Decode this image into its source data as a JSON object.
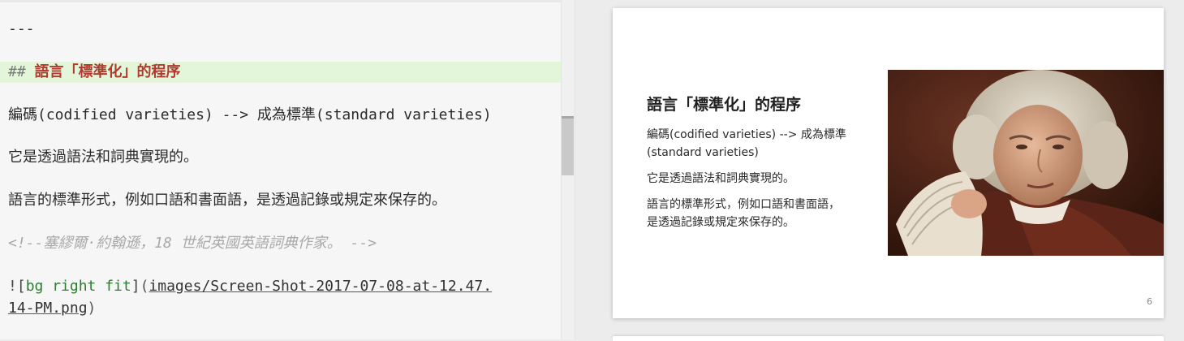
{
  "editor": {
    "separator": "---",
    "heading_mark": "##",
    "heading_text": "語言「標準化」的程序",
    "line_codified": "編碼(codified varieties) --> 成為標準(standard varieties)",
    "line_grammar": "它是透過語法和詞典實現的。",
    "line_forms": "語言的標準形式，例如口語和書面語，是透過記錄或規定來保存的。",
    "comment": "<!--塞繆爾·約翰遜，18  世紀英國英語詞典作家。 -->",
    "image_bang": "!",
    "image_alt_open": "[",
    "image_alt": "bg right fit",
    "image_alt_close": "]",
    "image_paren_open": "(",
    "image_url_line1": "images/Screen-Shot-2017-07-08-at-12.47.",
    "image_url_line2": "14-PM.png",
    "image_paren_close": ")"
  },
  "slide": {
    "title": "語言「標準化」的程序",
    "paragraph_1": "編碼(codified varieties) --> 成為標準 (standard varieties)",
    "paragraph_2": "它是透過語法和詞典實現的。",
    "paragraph_3": "語言的標準形式，例如口語和書面語，是透過記錄或規定來保存的。",
    "page_number": "6",
    "image_subject": "portrait-of-man-reading-book"
  },
  "colors": {
    "heading": "#b03a2e",
    "highlight_line": "#e4f6da",
    "alt_text": "#2e7d32",
    "comment": "#a9a9a9"
  }
}
